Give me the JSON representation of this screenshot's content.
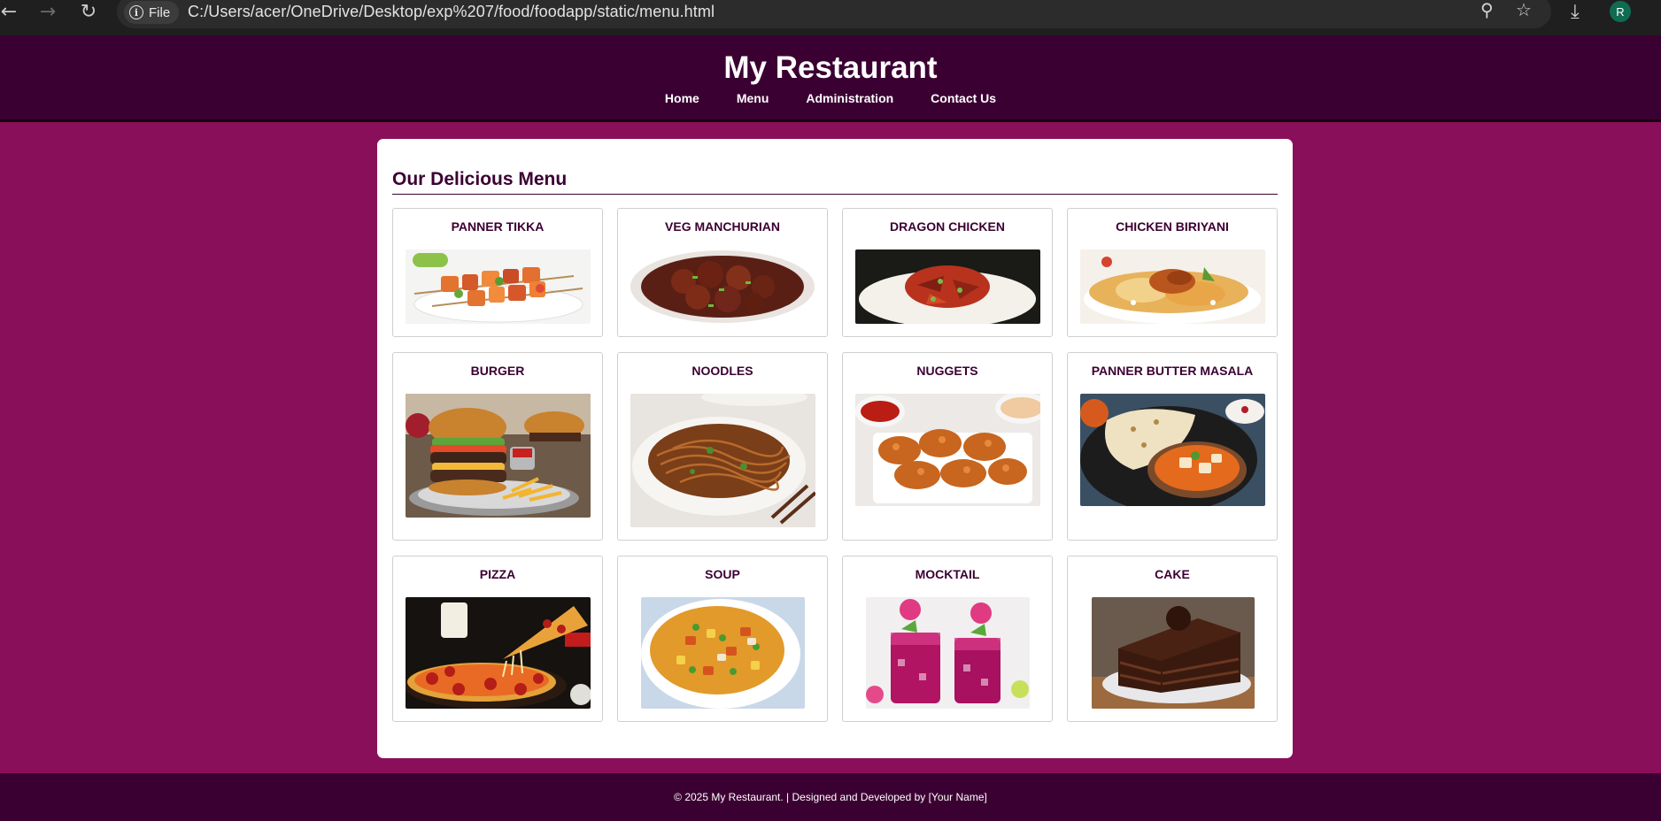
{
  "browser": {
    "site_chip_label": "File",
    "url": "C:/Users/acer/OneDrive/Desktop/exp%207/food/foodapp/static/menu.html",
    "profile_initial": "R"
  },
  "header": {
    "title": "My Restaurant",
    "nav": [
      "Home",
      "Menu",
      "Administration",
      "Contact Us"
    ]
  },
  "main": {
    "heading": "Our Delicious Menu",
    "items": [
      {
        "name": "PANNER TIKKA"
      },
      {
        "name": "VEG MANCHURIAN"
      },
      {
        "name": "DRAGON CHICKEN"
      },
      {
        "name": "CHICKEN BIRIYANI"
      },
      {
        "name": "BURGER"
      },
      {
        "name": "NOODLES"
      },
      {
        "name": "NUGGETS"
      },
      {
        "name": "PANNER BUTTER MASALA"
      },
      {
        "name": "PIZZA"
      },
      {
        "name": "SOUP"
      },
      {
        "name": "MOCKTAIL"
      },
      {
        "name": "CAKE"
      }
    ]
  },
  "footer": {
    "text": "© 2025 My Restaurant. | Designed and Developed by [Your Name]"
  },
  "colors": {
    "page_background": "#8a0f5a",
    "header_background": "#3b0032",
    "accent_text": "#3b0032"
  }
}
